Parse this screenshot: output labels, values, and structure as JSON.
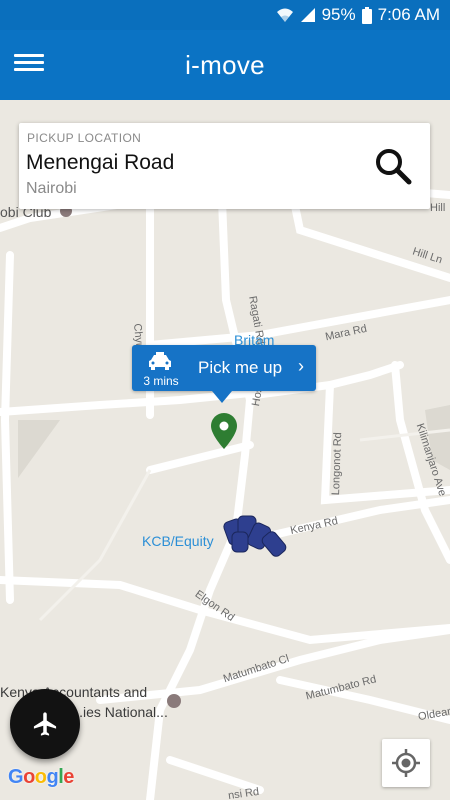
{
  "status_bar": {
    "battery": "95%",
    "time": "7:06 AM"
  },
  "app_bar": {
    "title": "i-move"
  },
  "pickup": {
    "label": "PICKUP LOCATION",
    "road": "Menengai Road",
    "city": "Nairobi"
  },
  "bubble": {
    "eta": "3 mins",
    "action": "Pick me up",
    "chevron": "›"
  },
  "map_labels": {
    "club": "obi Club",
    "hill_1": "Hill",
    "hill_ln": "Hill Ln",
    "ragati": "Ragati Rd",
    "mara": "Mara Rd",
    "britam": "Britam",
    "chyulu": "Chyulu",
    "hospital": "Hospital Rd",
    "longonot": "Longonot Rd",
    "kilimanjaro": "Kilimanjaro Ave",
    "kenya_rd": "Kenya Rd",
    "kcb": "KCB/Equity",
    "elgon": "Elgon Rd",
    "matumbato_cl": "Matumbato Cl",
    "matumbato_rd": "Matumbato Rd",
    "oldeani": "Oldeani",
    "kenya_acc_1": "Kenya Accountants and",
    "kenya_acc_2": "S...ies National...",
    "bottom_rd": "nsi Rd"
  },
  "brand": {
    "google": [
      "G",
      "o",
      "o",
      "g",
      "l",
      "e"
    ]
  },
  "colors": {
    "primary": "#0b73c4",
    "status_bar": "#0a6fbd",
    "bubble": "#1673c6",
    "pin": "#2e7d32",
    "map_bg": "#ebe8e1",
    "road": "#ffffff"
  }
}
